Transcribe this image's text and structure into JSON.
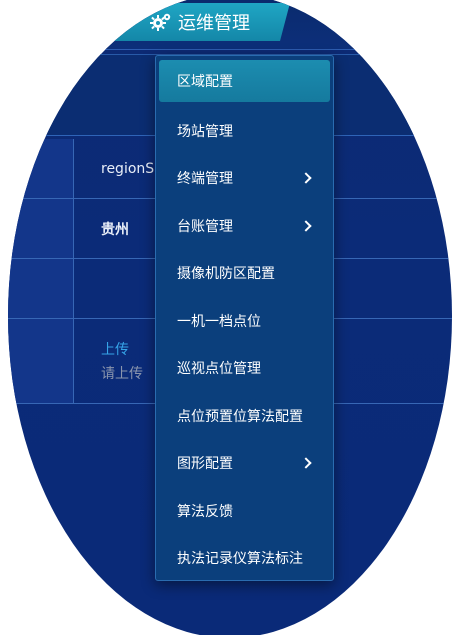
{
  "header": {
    "tab_label": "运维管理",
    "tab_icon": "gears-icon"
  },
  "table": {
    "rows": [
      {
        "value": "regionS"
      },
      {
        "value": "贵州"
      },
      {
        "value": ""
      },
      {
        "upload_label": "上传",
        "upload_hint": "请上传"
      }
    ]
  },
  "menu": {
    "items": [
      {
        "label": "区域配置",
        "active": true,
        "has_submenu": false
      },
      {
        "label": "场站管理",
        "active": false,
        "has_submenu": false
      },
      {
        "label": "终端管理",
        "active": false,
        "has_submenu": true
      },
      {
        "label": "台账管理",
        "active": false,
        "has_submenu": true
      },
      {
        "label": "摄像机防区配置",
        "active": false,
        "has_submenu": false
      },
      {
        "label": "一机一档点位",
        "active": false,
        "has_submenu": false
      },
      {
        "label": "巡视点位管理",
        "active": false,
        "has_submenu": false
      },
      {
        "label": "点位预置位算法配置",
        "active": false,
        "has_submenu": false
      },
      {
        "label": "图形配置",
        "active": false,
        "has_submenu": true
      },
      {
        "label": "算法反馈",
        "active": false,
        "has_submenu": false
      },
      {
        "label": "执法记录仪算法标注",
        "active": false,
        "has_submenu": false
      }
    ]
  },
  "colors": {
    "background": "#0b2b78",
    "menu_bg": "#0b3f7c",
    "menu_active": "#1c8db0",
    "tab_active": "#1fa6c4",
    "upload_link": "#36a4e8"
  }
}
